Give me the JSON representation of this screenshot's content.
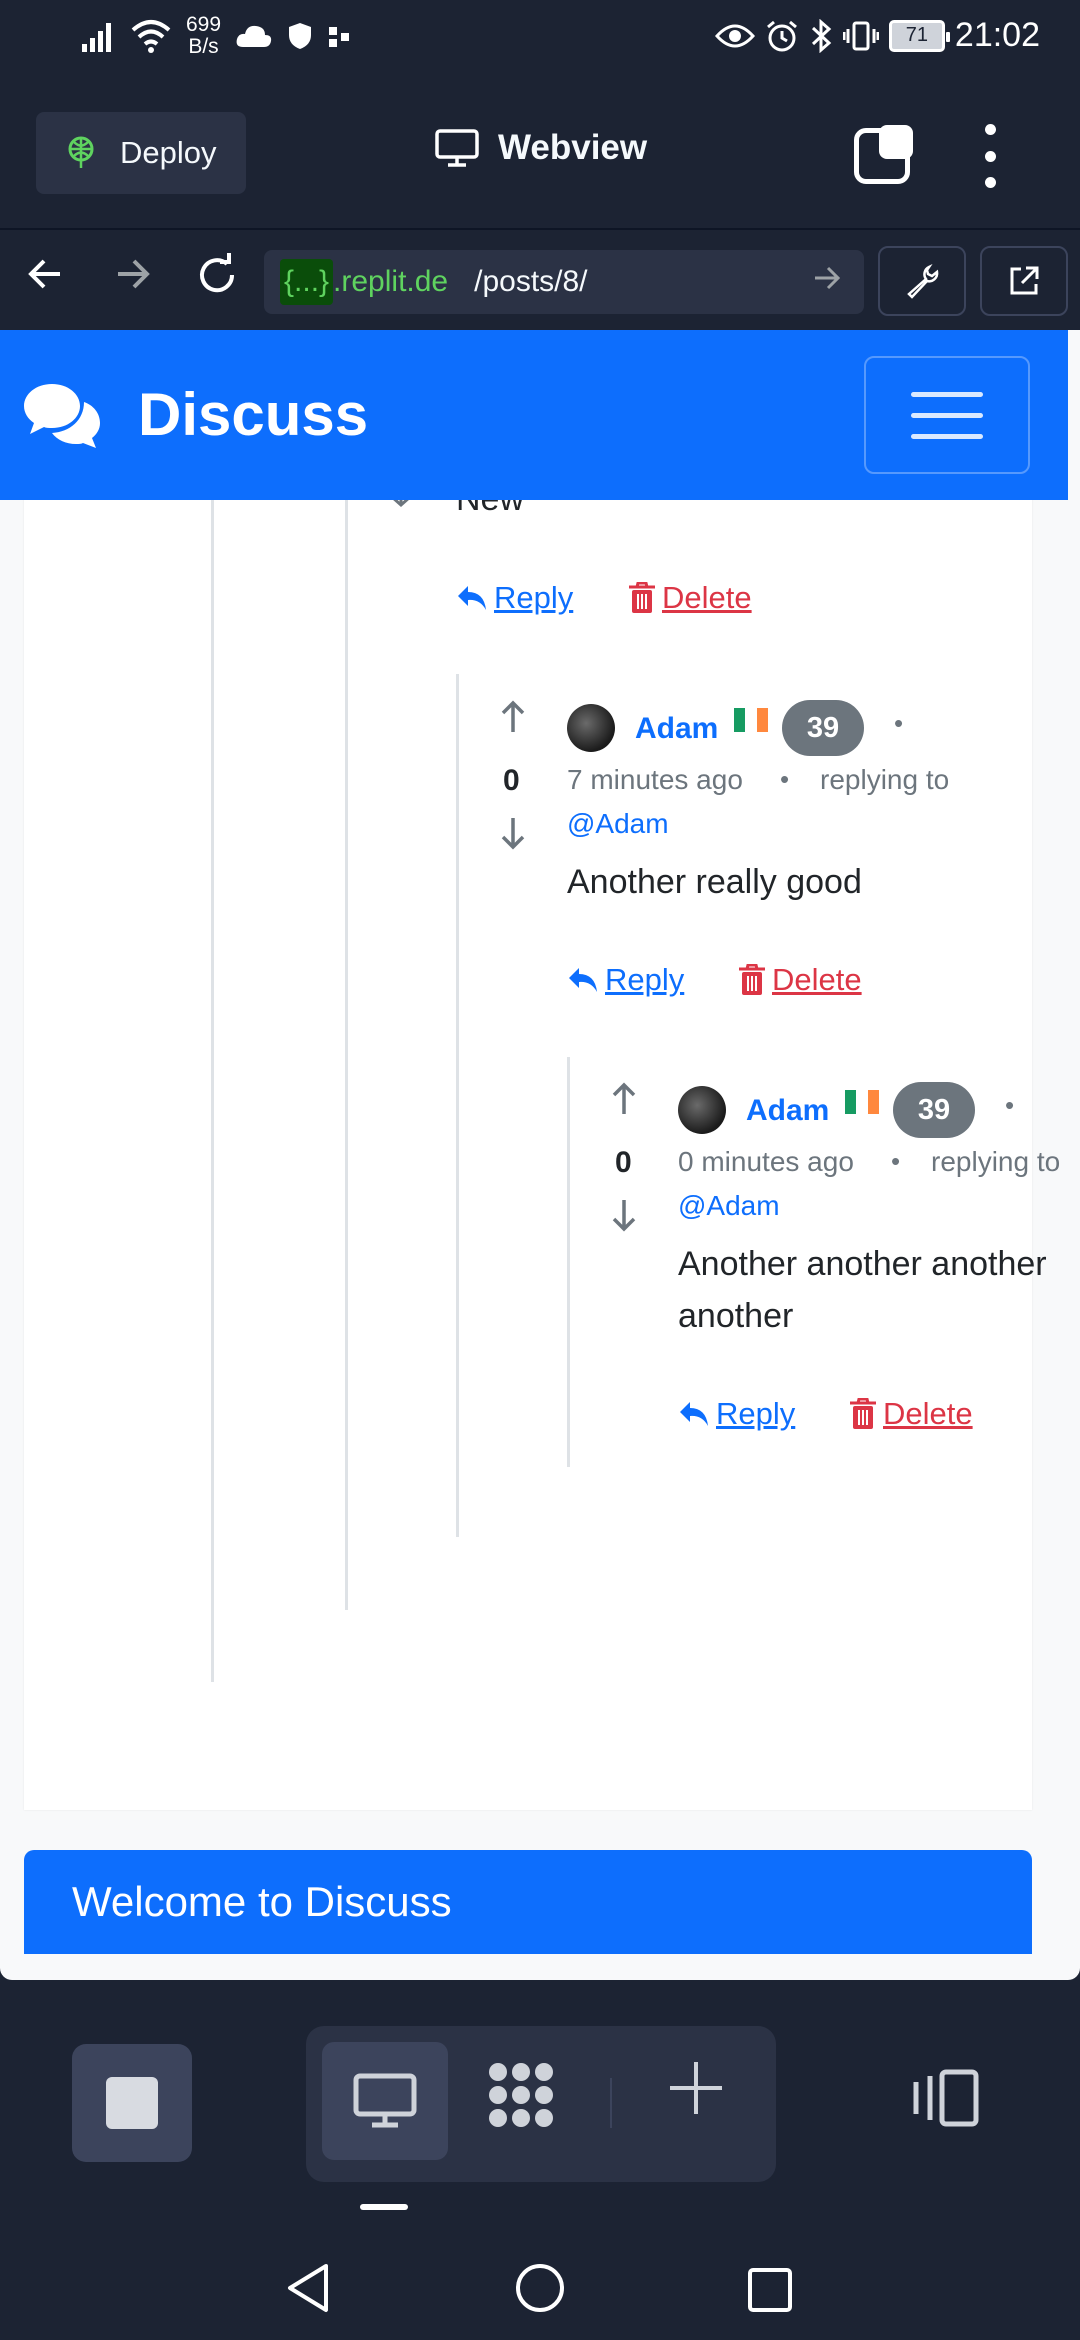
{
  "status_bar": {
    "network_speed_value": "699",
    "network_speed_unit": "B/s",
    "battery": "71",
    "time": "21:02"
  },
  "replit_header": {
    "deploy_label": "Deploy",
    "webview_label": "Webview"
  },
  "url_bar": {
    "repl_token": "{...}",
    "host": ".replit.de",
    "path": "/posts/8/"
  },
  "site": {
    "brand": "Discuss",
    "partial_text": "New"
  },
  "actions": {
    "reply_label": "Reply",
    "delete_label": "Delete"
  },
  "comments": [
    {
      "votes": "0",
      "author": "Adam",
      "badge": "39",
      "time_ago": "7 minutes ago",
      "replying_prefix": "replying to",
      "mention": "@Adam",
      "body": "Another really good"
    },
    {
      "votes": "0",
      "author": "Adam",
      "badge": "39",
      "time_ago": "0 minutes ago",
      "replying_prefix": "replying to",
      "mention": "@Adam",
      "body": "Another another another another"
    }
  ],
  "welcome_card": {
    "title": "Welcome to Discuss"
  },
  "colors": {
    "primary": "#0d6efd",
    "danger": "#dc3545",
    "muted": "#6c757d",
    "replit_dark": "#1c2333"
  },
  "icons": {
    "flag": "ireland-flag-icon",
    "vote_up": "arrow-up-icon",
    "vote_down": "arrow-down-icon"
  }
}
